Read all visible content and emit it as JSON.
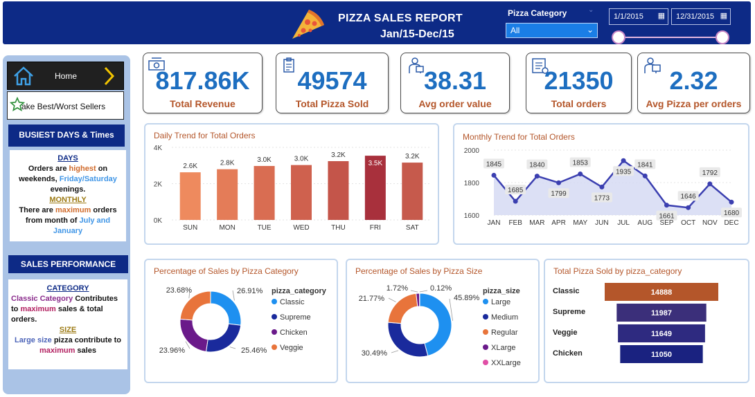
{
  "header": {
    "title": "PIZZA SALES REPORT",
    "subtitle": "Jan/15-Dec/15",
    "category_label": "Pizza Category",
    "category_value": "All",
    "date_start": "1/1/2015",
    "date_end": "12/31/2015"
  },
  "nav": {
    "home_label": "Home",
    "best_worst_label": "ake Best/Worst Sellers"
  },
  "busiest": {
    "heading": "BUSIEST DAYS & Times",
    "days_title": "DAYS",
    "days_t1": "Orders are ",
    "days_hl1": "highest",
    "days_t2": " on weekends, ",
    "days_hl2": "Friday/Saturday",
    "days_t3": " evenings.",
    "monthly_title": "MONTHLY",
    "monthly_t1": "There are ",
    "monthly_hl1": "maximum",
    "monthly_t2": " orders from month of ",
    "monthly_hl2": "July and January"
  },
  "sales_perf": {
    "heading": "SALES PERFORMANCE",
    "cat_title": "CATEGORY",
    "cat_hl1": "Classic Category",
    "cat_t1": " Contributes to ",
    "cat_hl2": "maximum",
    "cat_t2": " sales & total orders.",
    "size_title": "SIZE",
    "size_hl1": "Large size",
    "size_t1": " pizza contribute to ",
    "size_hl2": "maximum",
    "size_t2": " sales"
  },
  "kpis": [
    {
      "value": "817.86K",
      "label": "Total Revenue",
      "icon": "money-icon"
    },
    {
      "value": "49574",
      "label": "Total Pizza Sold",
      "icon": "clipboard-icon"
    },
    {
      "value": "38.31",
      "label": "Avg order value",
      "icon": "delivery-icon"
    },
    {
      "value": "21350",
      "label": "Total orders",
      "icon": "order-list-icon"
    },
    {
      "value": "2.32",
      "label": "Avg Pizza per orders",
      "icon": "delivery-box-icon"
    }
  ],
  "colors": {
    "navy": "#0d2a86",
    "kpi_value": "#1d6ec0",
    "kpi_label": "#b4562a",
    "cat_classic": "#1e90f0",
    "cat_supreme": "#1a2a9c",
    "cat_chicken": "#6a1a8a",
    "cat_veggie": "#e8743b",
    "size_xxlarge": "#e04fa6"
  },
  "chart_data": [
    {
      "type": "bar",
      "title": "Daily Trend for Total Orders",
      "categories": [
        "SUN",
        "MON",
        "TUE",
        "WED",
        "THU",
        "FRI",
        "SAT"
      ],
      "values": [
        2624,
        2794,
        2973,
        3024,
        3239,
        3538,
        3158
      ],
      "data_labels": [
        "2.6K",
        "2.8K",
        "3.0K",
        "3.0K",
        "3.2K",
        "3.5K",
        "3.2K"
      ],
      "yticks": [
        "0K",
        "2K",
        "4K"
      ],
      "ylim": [
        0,
        4000
      ],
      "bar_colors": [
        "#ee8a5e",
        "#e47c58",
        "#d96d52",
        "#cf614e",
        "#c4554a",
        "#a8303c",
        "#c65a4c"
      ]
    },
    {
      "type": "area",
      "title": "Monthly Trend for Total Orders",
      "categories": [
        "JAN",
        "FEB",
        "MAR",
        "APR",
        "MAY",
        "JUN",
        "JUL",
        "AUG",
        "SEP",
        "OCT",
        "NOV",
        "DEC"
      ],
      "values": [
        1845,
        1685,
        1840,
        1799,
        1853,
        1773,
        1935,
        1841,
        1661,
        1646,
        1792,
        1680
      ],
      "data_labels": [
        "1845",
        "1685",
        "1840",
        "1799",
        "1853",
        "1773",
        "1935",
        "1841",
        "1661",
        "1646",
        "1792",
        "1680"
      ],
      "yticks": [
        "1600",
        "1800",
        "2000"
      ],
      "ylim": [
        1600,
        2000
      ]
    },
    {
      "type": "pie",
      "title": "Percentage of Sales by Pizza Category",
      "legend_title": "pizza_category",
      "labels": [
        "Classic",
        "Supreme",
        "Chicken",
        "Veggie"
      ],
      "values": [
        26.91,
        25.46,
        23.96,
        23.68
      ],
      "data_labels": [
        "26.91%",
        "25.46%",
        "23.96%",
        "23.68%"
      ],
      "colors": [
        "#1e90f0",
        "#1a2a9c",
        "#6a1a8a",
        "#e8743b"
      ]
    },
    {
      "type": "pie",
      "title": "Percentage of Sales by Pizza Size",
      "legend_title": "pizza_size",
      "labels": [
        "Large",
        "Medium",
        "Regular",
        "XLarge",
        "XXLarge"
      ],
      "values": [
        45.89,
        30.49,
        21.77,
        1.72,
        0.12
      ],
      "data_labels": [
        "45.89%",
        "30.49%",
        "21.77%",
        "1.72%",
        "0.12%"
      ],
      "colors": [
        "#1e90f0",
        "#1a2a9c",
        "#e8743b",
        "#6a1a8a",
        "#e04fa6"
      ]
    },
    {
      "type": "bar",
      "orientation": "horizontal",
      "title": "Total Pizza Sold by pizza_category",
      "categories": [
        "Classic",
        "Supreme",
        "Veggie",
        "Chicken"
      ],
      "values": [
        14888,
        11987,
        11649,
        11050
      ],
      "data_labels": [
        "14888",
        "11987",
        "11649",
        "11050"
      ],
      "bar_colors": [
        "#b4562a",
        "#3b2f7a",
        "#2e2a80",
        "#1a2280"
      ]
    }
  ]
}
